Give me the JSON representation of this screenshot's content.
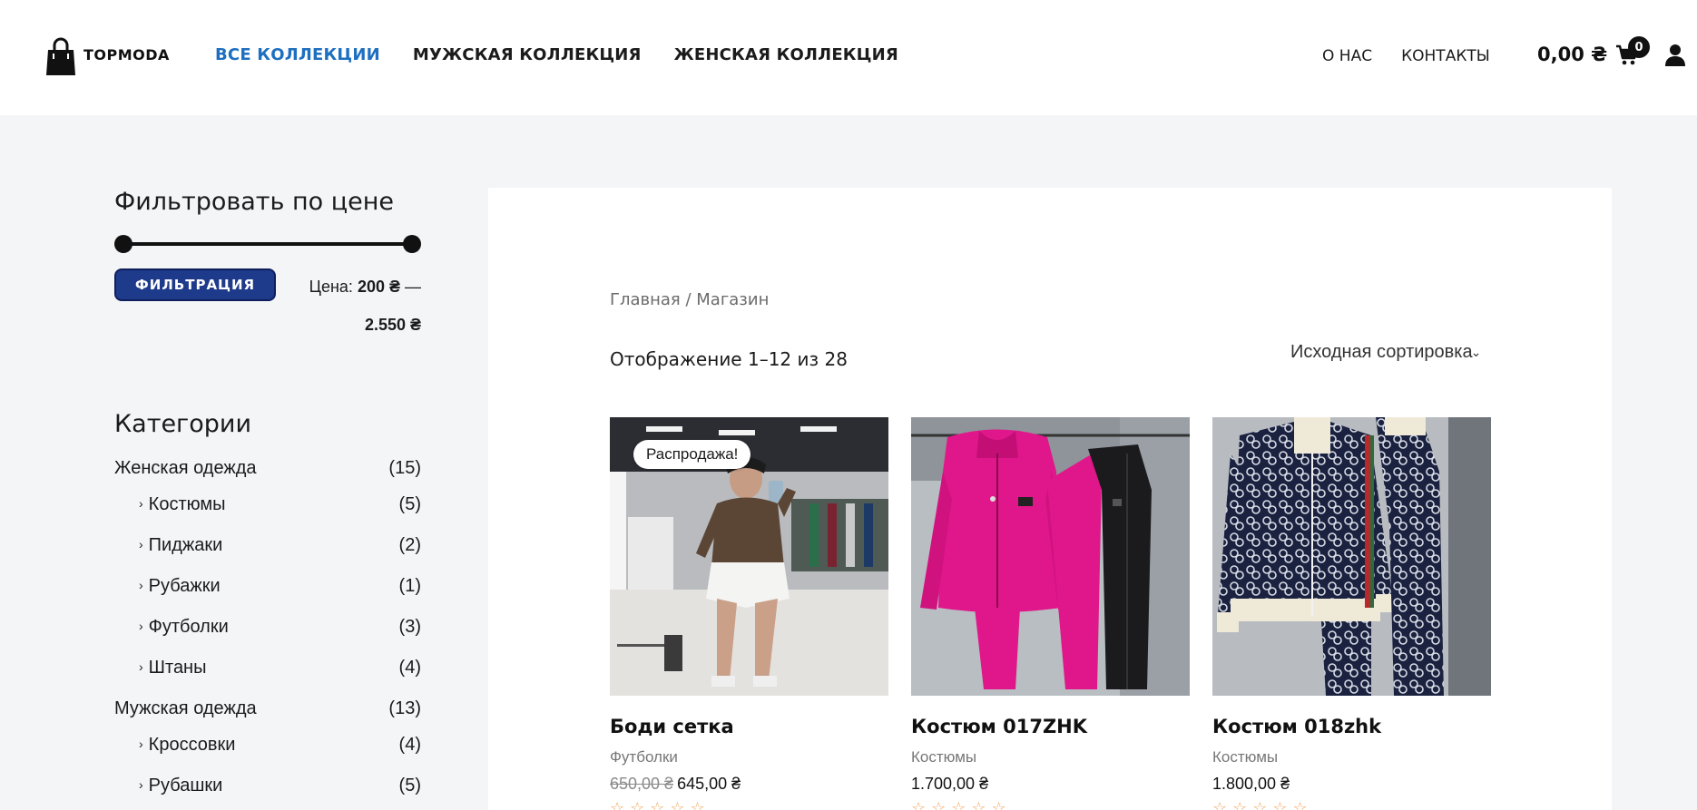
{
  "header": {
    "logo_text": "TOPMODA",
    "nav": [
      {
        "label": "ВСЕ КОЛЛЕКЦИИ",
        "active": true
      },
      {
        "label": "МУЖСКАЯ КОЛЛЕКЦИЯ",
        "active": false
      },
      {
        "label": "ЖЕНСКАЯ КОЛЛЕКЦИЯ",
        "active": false
      }
    ],
    "right_nav": [
      {
        "label": "О НАС"
      },
      {
        "label": "КОНТАКТЫ"
      }
    ],
    "cart_total": "0,00 ₴",
    "cart_count": "0",
    "icons": {
      "cart": "cart-icon",
      "user": "user-icon",
      "logo": "shopping-bag-icon"
    }
  },
  "sidebar": {
    "price_filter": {
      "title": "Фильтровать по цене",
      "button_label": "ФИЛЬТРАЦИЯ",
      "price_prefix": "Цена:",
      "min": "200 ₴",
      "separator": "—",
      "max": "2.550 ₴"
    },
    "categories": {
      "title": "Категории",
      "groups": [
        {
          "name": "Женская одежда",
          "count": "(15)",
          "children": [
            {
              "name": "Костюмы",
              "count": "(5)"
            },
            {
              "name": "Пиджаки",
              "count": "(2)"
            },
            {
              "name": "Рубажки",
              "count": "(1)"
            },
            {
              "name": "Футболки",
              "count": "(3)"
            },
            {
              "name": "Штаны",
              "count": "(4)"
            }
          ]
        },
        {
          "name": "Мужская одежда",
          "count": "(13)",
          "children": [
            {
              "name": "Кроссовки",
              "count": "(4)"
            },
            {
              "name": "Рубашки",
              "count": "(5)"
            }
          ]
        }
      ]
    }
  },
  "main": {
    "breadcrumb": "Главная / Магазин",
    "result_count": "Отображение 1–12 из 28",
    "sort_selected": "Исходная сортировка",
    "products": [
      {
        "title": "Боди сетка",
        "category": "Футболки",
        "old_price": "650,00 ₴",
        "price": "645,00 ₴",
        "sale_badge": "Распродажа!",
        "stars": "☆☆☆☆☆"
      },
      {
        "title": "Костюм 017ZHK",
        "category": "Костюмы",
        "old_price": "",
        "price": "1.700,00 ₴",
        "sale_badge": "",
        "stars": "☆☆☆☆☆"
      },
      {
        "title": "Костюм 018zhk",
        "category": "Костюмы",
        "old_price": "",
        "price": "1.800,00 ₴",
        "sale_badge": "",
        "stars": "☆☆☆☆☆"
      }
    ]
  },
  "colors": {
    "accent": "#1e6fc0",
    "button": "#1e3a8a",
    "background": "#f4f5f7",
    "stars": "#f0a35a"
  }
}
